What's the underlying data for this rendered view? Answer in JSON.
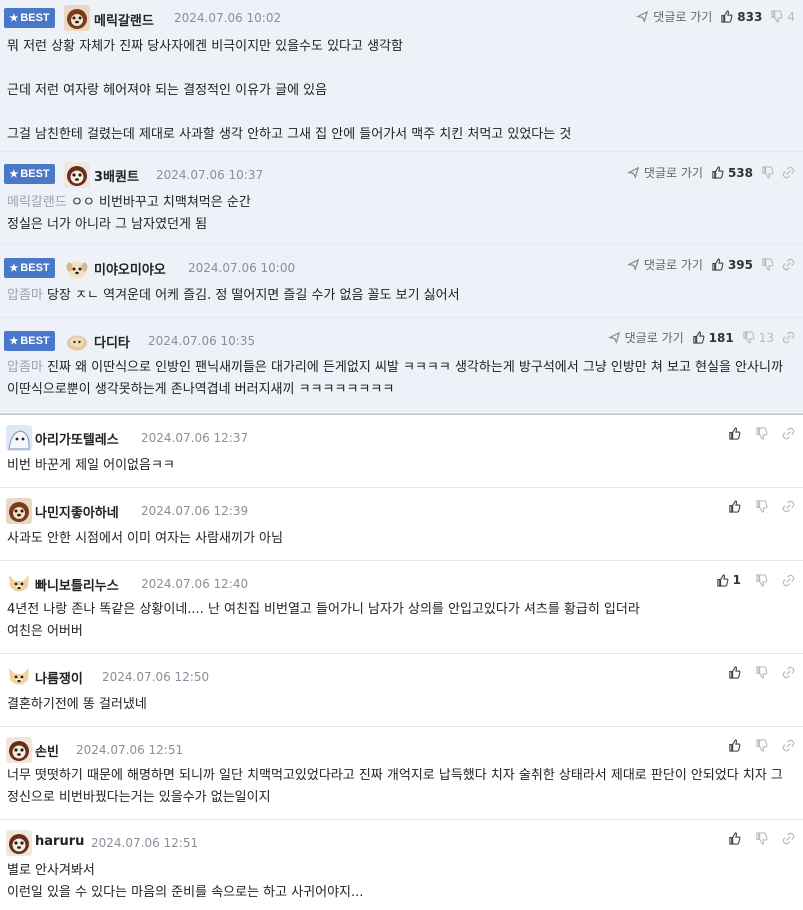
{
  "ui": {
    "best_label": "BEST",
    "reply_label": "댓글로 가기"
  },
  "best_comments": [
    {
      "nick": "메릭갈랜드",
      "date": "2024.07.06 10:02",
      "up": "833",
      "down": "4",
      "text": "뭐 저런 상황 자체가 진짜 당사자에겐 비극이지만 있을수도 있다고 생각함\n\n근데 저런 여자랑 헤어져야 되는 결정적인 이유가 글에 있음\n\n그걸 남친한테 걸렸는데 제대로 사과할 생각 안하고 그새 집 안에 들어가서 맥주 치킨 처먹고 있었다는 것"
    },
    {
      "nick": "3배퀀트",
      "date": "2024.07.06 10:37",
      "up": "538",
      "down": "",
      "quote": "메릭갈랜드",
      "text": " ㅇㅇ 비번바꾸고 치맥쳐먹은 순간\n정실은 너가 아니라 그 남자였던게 됨"
    },
    {
      "nick": "미야오미야오",
      "date": "2024.07.06 10:00",
      "up": "395",
      "down": "",
      "quote": "압좀마",
      "text": " 당장 ㅈㄴ 역겨운데 어케 즐김. 정 떨어지면 즐길 수가 없음 꼴도 보기 싫어서"
    },
    {
      "nick": "다디타",
      "date": "2024.07.06 10:35",
      "up": "181",
      "down": "13",
      "quote": "압좀마",
      "text": " 진짜 왜 이딴식으로 인방인 팬닉새끼들은 대가리에 든게없지 씨발 ㅋㅋㅋㅋ 생각하는게 방구석에서 그냥 인방만 쳐 보고 현실을 안사니까 이딴식으로뿐이 생각못하는게 존나역겹네 버러지새끼 ㅋㅋㅋㅋㅋㅋㅋㅋ"
    }
  ],
  "comments": [
    {
      "nick": "아리가또텔레스",
      "date": "2024.07.06 12:37",
      "up": "",
      "text": "비번 바꾼게 제일 어이없음ㅋㅋ"
    },
    {
      "nick": "나민지좋아하네",
      "date": "2024.07.06 12:39",
      "up": "",
      "text": "사과도 안한 시점에서 이미 여자는 사람새끼가 아님"
    },
    {
      "nick": "빠니보틀리누스",
      "date": "2024.07.06 12:40",
      "up": "1",
      "text": "4년전 나랑 존나 똑같은 상황이네.... 난 여친집 비번열고 들어가니 남자가 상의를 안입고있다가 셔츠를 황급히 입더라\n여친은 어버버"
    },
    {
      "nick": "나름쟁이",
      "date": "2024.07.06 12:50",
      "up": "",
      "text": "결혼하기전에 똥 걸러냈네"
    },
    {
      "nick": "손빈",
      "date": "2024.07.06 12:51",
      "up": "",
      "text": "너무 떳떳하기 때문에 해명하면 되니까 일단 치맥먹고있었다라고 진짜 개억지로 납득했다 치자 술취한 상태라서 제대로 판단이 안되었다 치자 그 정신으로 비번바꿨다는거는 있을수가 없는일이지"
    },
    {
      "nick": "haruru",
      "date": "2024.07.06 12:51",
      "up": "",
      "text": "별로 안사겨봐서\n이런일 있을 수 있다는 마음의 준비를 속으로는 하고 사귀어야지..."
    }
  ],
  "colors": {
    "best_bg": "#eef1f7",
    "badge": "#4a78c8",
    "muted_text": "#8a8f99",
    "quote_text": "#9aa3b1"
  },
  "icons": [
    "star-icon",
    "avatar",
    "reply-arrow-icon",
    "thumbs-up-icon",
    "thumbs-down-icon",
    "link-icon"
  ]
}
